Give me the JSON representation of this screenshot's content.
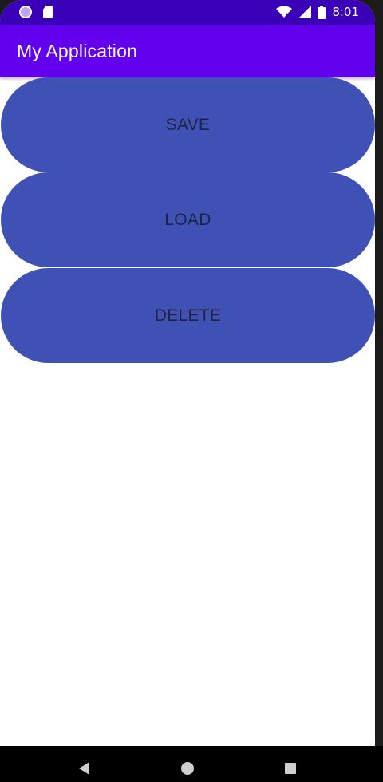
{
  "status_bar": {
    "time": "8:01",
    "icons": [
      "notification-circle-icon",
      "sd-card-icon",
      "wifi-icon",
      "signal-icon",
      "battery-icon"
    ]
  },
  "app_bar": {
    "title": "My Application"
  },
  "buttons": {
    "save": "SAVE",
    "load": "LOAD",
    "delete": "DELETE"
  },
  "nav_bar": {
    "icons": [
      "back-icon",
      "home-icon",
      "recents-icon"
    ]
  },
  "colors": {
    "status_bar": "#3a00b8",
    "app_bar": "#6200ee",
    "button_fill": "#3f51b5",
    "button_text": "#1f2340"
  }
}
